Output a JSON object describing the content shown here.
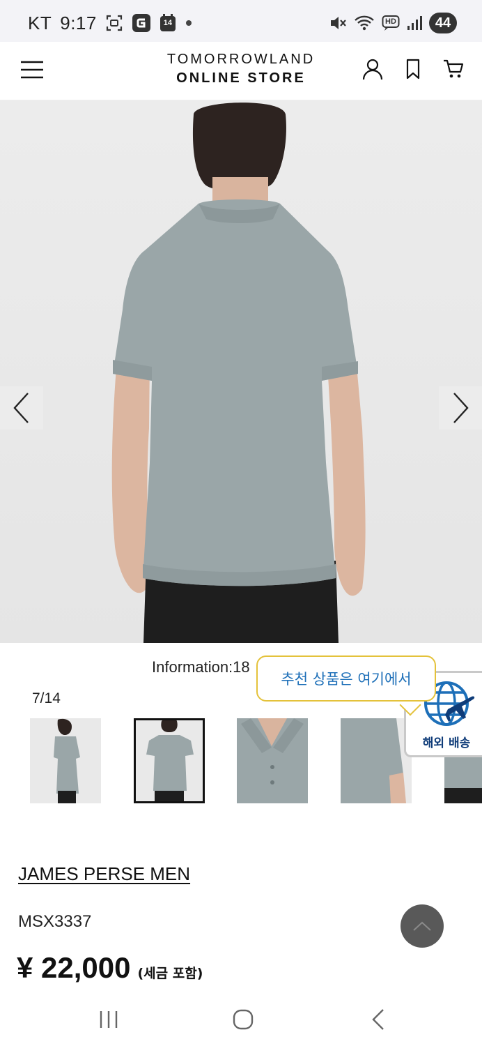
{
  "status_bar": {
    "carrier": "KT",
    "time": "9:17",
    "calendar_day": "14",
    "network": "HD",
    "battery": "44"
  },
  "header": {
    "logo_line1": "TOMORROWLAND",
    "logo_line2": "ONLINE STORE",
    "icons": [
      "menu-icon",
      "account-icon",
      "bookmark-icon",
      "cart-icon"
    ]
  },
  "gallery": {
    "info_text": "Information:18",
    "counter": "7/14",
    "current_index": 7,
    "total": 14
  },
  "recommend": {
    "bubble_text": "추천 상품은 여기에서",
    "badge_label": "해외 배송"
  },
  "product": {
    "brand": "JAMES PERSE MEN",
    "sku": "MSX3337",
    "price": "¥ 22,000",
    "tax_note": "(세금 포함)"
  },
  "colors": {
    "shirt": "#9aa6a8",
    "bubble_border": "#e4c23b",
    "bubble_text": "#1d6fb8",
    "badge_text": "#0f3c79",
    "to_top_button": "#595959"
  }
}
